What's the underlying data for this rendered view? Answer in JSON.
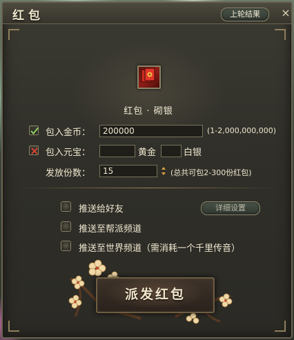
{
  "window": {
    "title": "红包",
    "last_result_label": "上轮结果",
    "close_glyph": "×"
  },
  "item": {
    "icon": "red-envelope-icon",
    "name": "红包 · 砌银"
  },
  "gold_coin": {
    "checked": true,
    "label": "包入金币：",
    "value": "200000",
    "range": "(1-2,000,000,000)"
  },
  "yuanbao": {
    "checked": false,
    "label": "包入元宝：",
    "gold_value": "",
    "gold_unit": "黄金",
    "silver_value": "",
    "silver_unit": "白银"
  },
  "count": {
    "label": "发放份数：",
    "value": "15",
    "hint": "(总共可包2-300份红包)"
  },
  "options": {
    "send_friends": "推送给好友",
    "detail_button": "详细设置",
    "send_guild": "推送至帮派频道",
    "send_world": "推送至世界频道（需消耗一个千里传音）"
  },
  "send_button": "派发红包",
  "colors": {
    "accent": "#f2ead3",
    "frame": "#8d8468",
    "panel": "#302f29",
    "envelope_red": "#8f1d17"
  }
}
